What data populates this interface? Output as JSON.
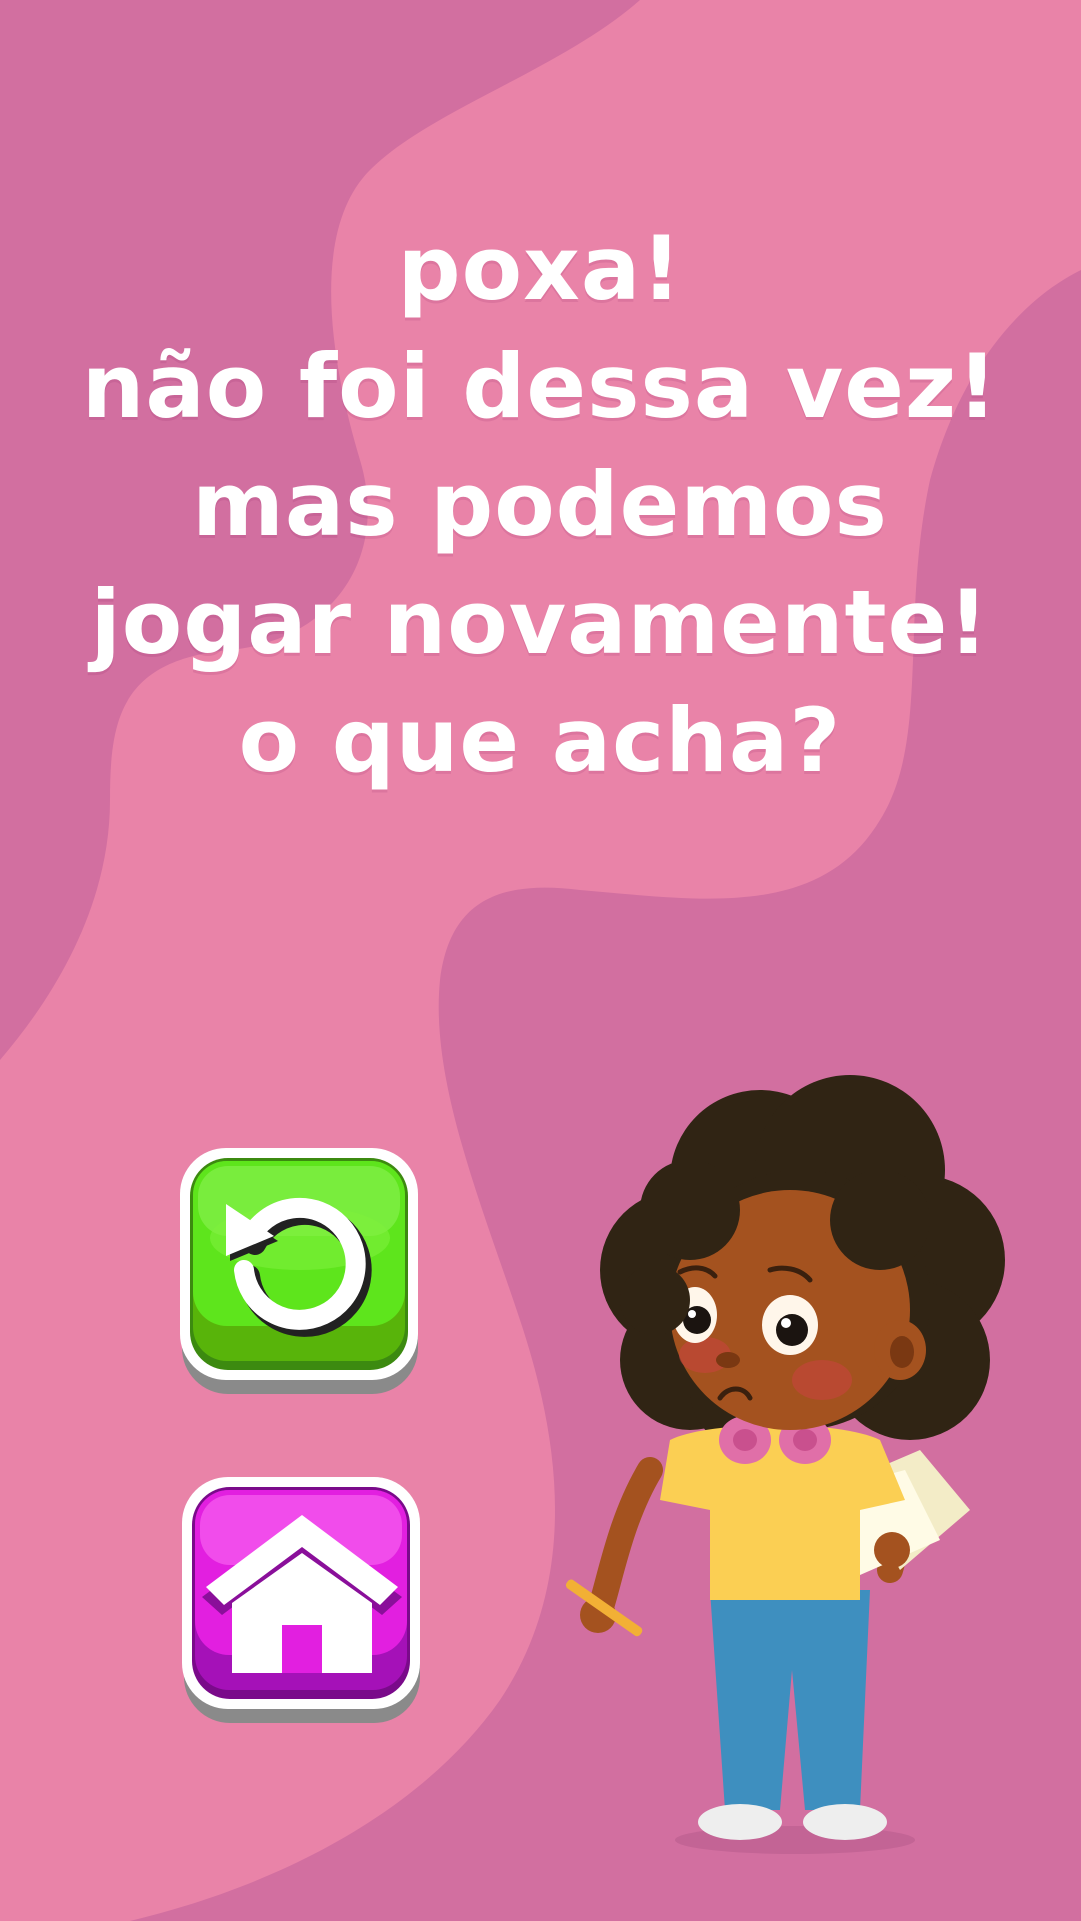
{
  "screen": "game-over",
  "colors": {
    "background_dark": "#d26fa0",
    "background_light": "#e983a8",
    "text": "#ffffff",
    "retry_green": "#5ee51c",
    "home_magenta": "#e21fe0"
  },
  "message": {
    "lines": [
      "poxa!",
      "não foi dessa vez!",
      "mas podemos",
      "jogar novamente!",
      "o que acha?"
    ]
  },
  "buttons": {
    "retry": {
      "icon": "restart-icon"
    },
    "home": {
      "icon": "home-icon"
    }
  },
  "character": {
    "icon": "sad-girl-character"
  }
}
